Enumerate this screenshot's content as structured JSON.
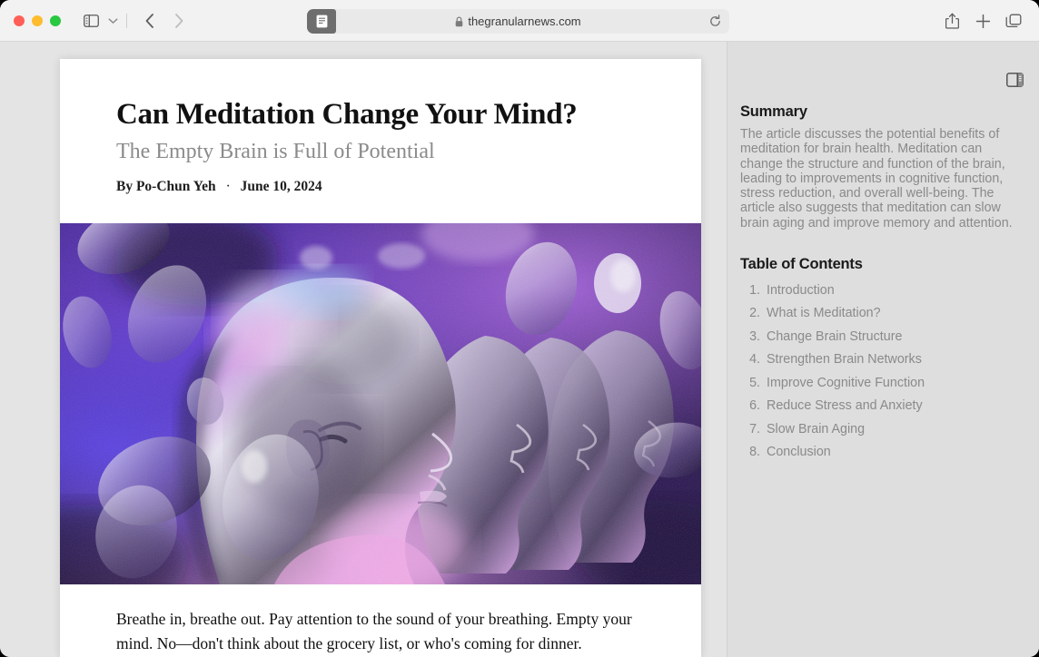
{
  "window": {
    "traffic_lights": [
      {
        "name": "close",
        "color": "#ff5f57"
      },
      {
        "name": "minimize",
        "color": "#febc2e"
      },
      {
        "name": "maximize",
        "color": "#28c840"
      }
    ]
  },
  "toolbar": {
    "sidebar_toggle_icon": "sidebar-icon",
    "tab_overview_chevron_icon": "chevron-down-icon",
    "back_icon": "chevron-left-icon",
    "forward_icon": "chevron-right-icon",
    "share_icon": "share-icon",
    "new_tab_icon": "plus-icon",
    "tabs_icon": "tab-overview-icon"
  },
  "urlbar": {
    "reader_icon": "reader-mode-icon",
    "lock_icon": "lock-icon",
    "url": "thegranularnews.com",
    "reload_icon": "reload-icon"
  },
  "article": {
    "title": "Can Meditation Change Your Mind?",
    "subtitle": "The Empty Brain is Full of Potential",
    "byline_author": "By Po-Chun Yeh",
    "byline_separator": "·",
    "byline_date": "June 10, 2024",
    "hero_alt": "abstract-illustration-layered-head-profiles",
    "body_paragraph": "Breathe in, breathe out. Pay attention to the sound of your breathing. Empty your mind. No—don't think about the grocery list, or who's coming for dinner."
  },
  "panel": {
    "toggle_icon": "sidebar-right-toggle-icon",
    "summary_heading": "Summary",
    "summary_text": "The article discusses the potential benefits of meditation for brain health. Meditation can change the structure and function of the brain, leading to improvements in cognitive function, stress reduction, and overall well-being. The article also suggests that meditation can slow brain aging and improve memory and attention.",
    "toc_heading": "Table of Contents",
    "toc": [
      {
        "num": "1.",
        "label": "Introduction"
      },
      {
        "num": "2.",
        "label": "What is Meditation?"
      },
      {
        "num": "3.",
        "label": "Change Brain Structure"
      },
      {
        "num": "4.",
        "label": "Strengthen Brain Networks"
      },
      {
        "num": "5.",
        "label": "Improve Cognitive Function"
      },
      {
        "num": "6.",
        "label": "Reduce Stress and Anxiety"
      },
      {
        "num": "7.",
        "label": "Slow Brain Aging"
      },
      {
        "num": "8.",
        "label": "Conclusion"
      }
    ]
  },
  "colors": {
    "toolbar_bg": "#f2f2f2",
    "page_bg": "#e4e4e4",
    "panel_bg": "#dedede",
    "card_bg": "#ffffff",
    "muted_text": "#8a8a8a",
    "heading_text": "#1a1a1a"
  }
}
